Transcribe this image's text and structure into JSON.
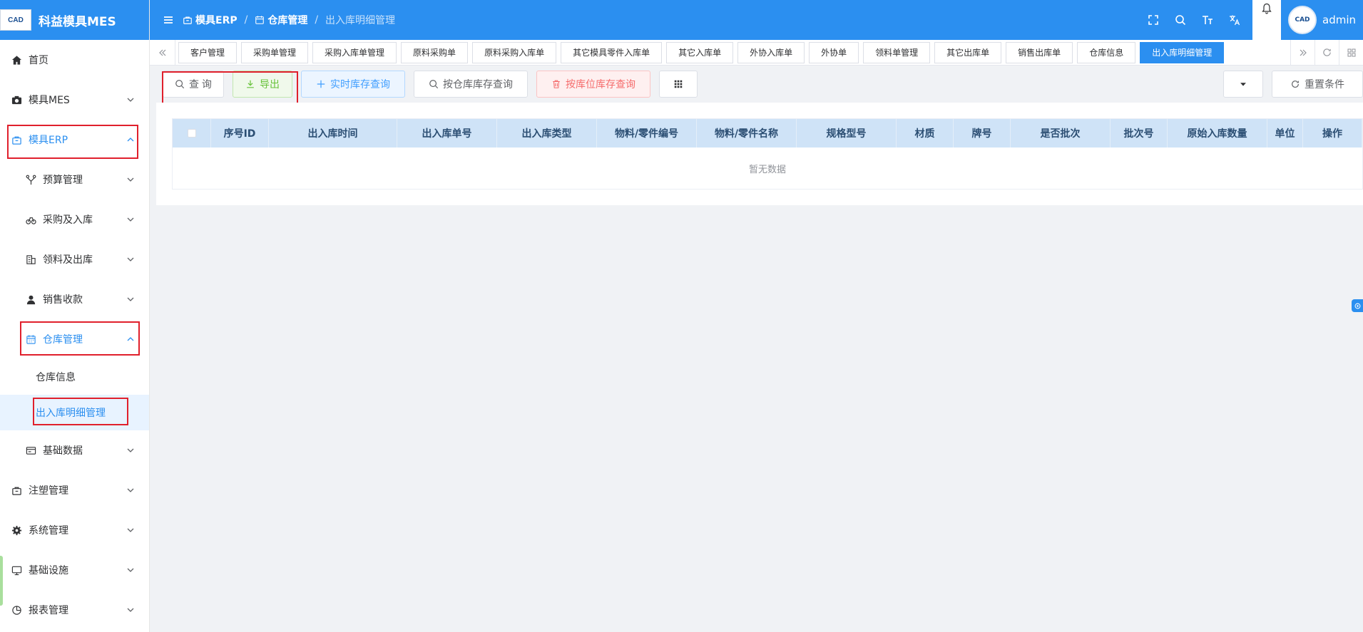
{
  "app": {
    "logo_text": "CAD",
    "title": "科益模具MES"
  },
  "sidebar": {
    "items": [
      {
        "label": "首页",
        "icon": "home-icon"
      },
      {
        "label": "模具MES",
        "icon": "camera-icon"
      },
      {
        "label": "模具ERP",
        "icon": "bag-icon"
      },
      {
        "label": "预算管理",
        "icon": "tree-icon"
      },
      {
        "label": "采购及入库",
        "icon": "bike-icon"
      },
      {
        "label": "领料及出库",
        "icon": "building-icon"
      },
      {
        "label": "销售收款",
        "icon": "user-icon"
      },
      {
        "label": "仓库管理",
        "icon": "calendar-icon"
      },
      {
        "label": "仓库信息"
      },
      {
        "label": "出入库明细管理"
      },
      {
        "label": "基础数据",
        "icon": "card-icon"
      },
      {
        "label": "注塑管理",
        "icon": "bag-icon"
      },
      {
        "label": "系统管理",
        "icon": "gear-icon"
      },
      {
        "label": "基础设施",
        "icon": "monitor-icon"
      },
      {
        "label": "报表管理",
        "icon": "piechart-icon"
      }
    ]
  },
  "header": {
    "breadcrumb": [
      "模具ERP",
      "仓库管理",
      "出入库明细管理"
    ],
    "separator": "/",
    "avatar_text": "CAD",
    "user": "admin"
  },
  "tabs": [
    "客户管理",
    "采购单管理",
    "采购入库单管理",
    "原料采购单",
    "原料采购入库单",
    "其它模具零件入库单",
    "其它入库单",
    "外协入库单",
    "外协单",
    "领料单管理",
    "其它出库单",
    "销售出库单",
    "仓库信息",
    "出入库明细管理"
  ],
  "toolbar": {
    "query": "查 询",
    "export": "导出",
    "realtime": "实时库存查询",
    "by_warehouse": "按仓库库存查询",
    "by_location": "按库位库存查询",
    "reset": "重置条件"
  },
  "table": {
    "columns": [
      "序号ID",
      "出入库时间",
      "出入库单号",
      "出入库类型",
      "物料/零件编号",
      "物料/零件名称",
      "规格型号",
      "材质",
      "牌号",
      "是否批次",
      "批次号",
      "原始入库数量",
      "单位",
      "操作"
    ],
    "empty_text": "暂无数据"
  },
  "colors": {
    "primary": "#2b8ff0",
    "highlight_box": "#e0202c",
    "header_row": "#cfe3f7"
  }
}
